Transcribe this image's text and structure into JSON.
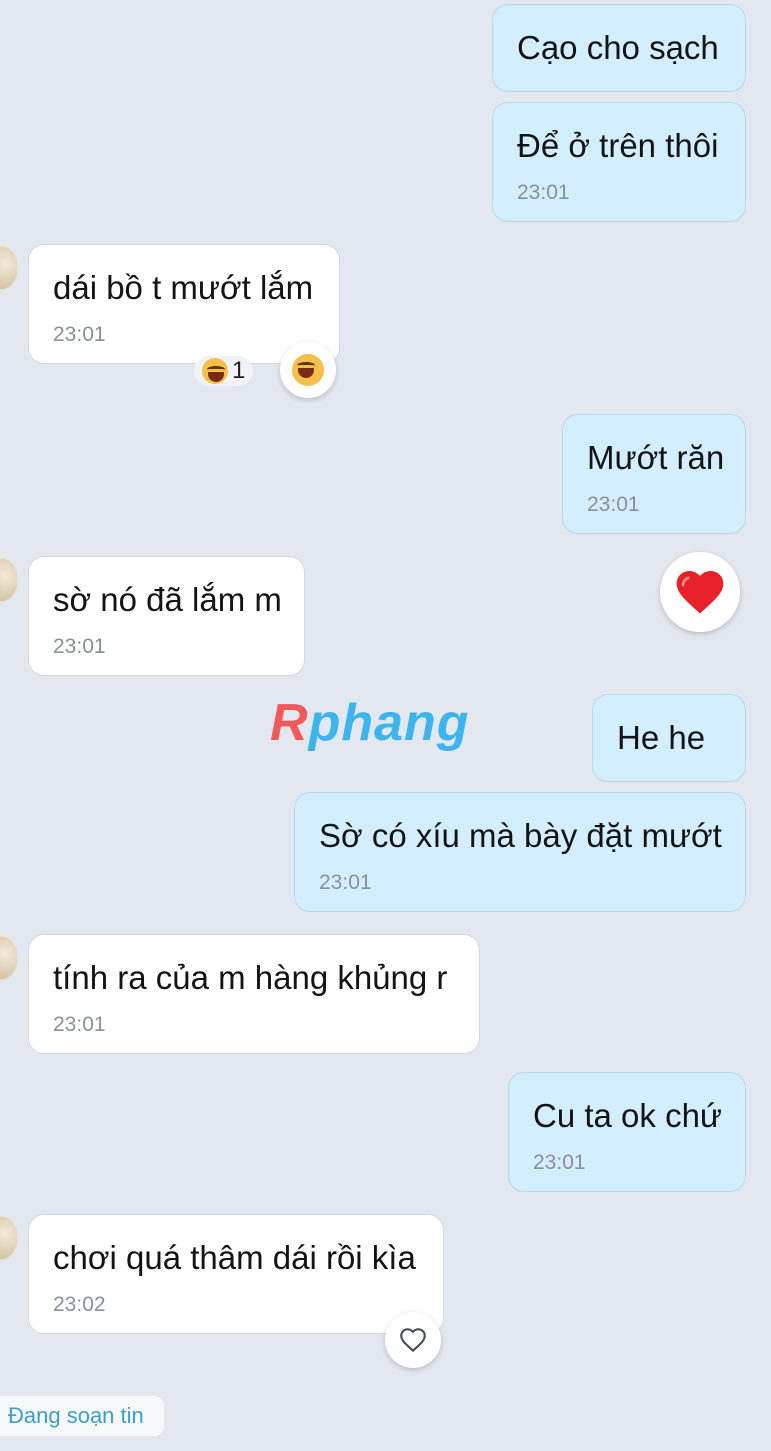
{
  "messages": [
    {
      "text": "Cạo cho sạch",
      "time": ""
    },
    {
      "text": "Để ở trên thôi",
      "time": "23:01"
    },
    {
      "text": "dái bồ t mướt lắm",
      "time": "23:01"
    },
    {
      "text": "Mướt răn",
      "time": "23:01"
    },
    {
      "text": "sờ nó đã lắm m",
      "time": "23:01"
    },
    {
      "text": "He he",
      "time": ""
    },
    {
      "text": "Sờ có xíu mà bày đặt mướt",
      "time": "23:01"
    },
    {
      "text": "tính ra của m hàng khủng r",
      "time": "23:01"
    },
    {
      "text": "Cu ta ok chứ",
      "time": "23:01"
    },
    {
      "text": "chơi quá thâm dái rồi kìa",
      "time": "23:02"
    }
  ],
  "reactions": {
    "laugh_count": "1"
  },
  "watermark": {
    "first": "R",
    "rest": "phang"
  },
  "status": {
    "typing": "Đang soạn tin"
  },
  "icons": {
    "laugh": "laughing-face-icon",
    "heart": "red-heart-icon",
    "heart_outline": "heart-outline-icon"
  },
  "colors": {
    "outgoing_bubble": "#d3efff",
    "incoming_bubble": "#ffffff",
    "background": "#e3e7f0",
    "heart": "#e8202a"
  }
}
